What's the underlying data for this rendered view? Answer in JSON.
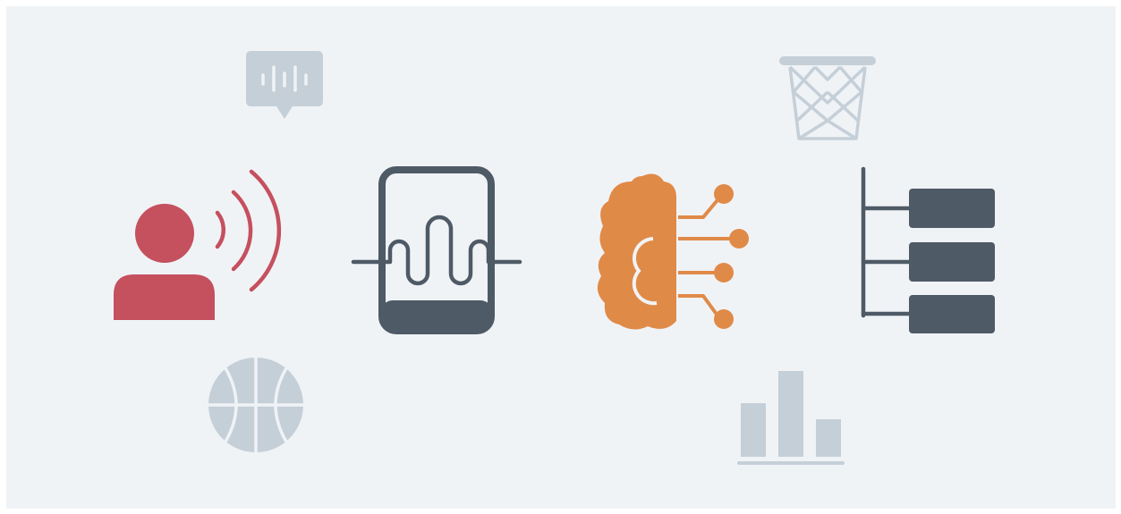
{
  "colors": {
    "background": "#f0f3f6",
    "speaker": "#c5505e",
    "phone": "#4e5a66",
    "brain": "#e08a48",
    "hierarchy": "#4e5a66",
    "decor": "#c5cfd8"
  },
  "icons": {
    "speech_bubble": "speech-waveform-bubble-icon",
    "basketball_hoop": "basketball-hoop-icon",
    "person_speaking": "person-speaking-icon",
    "phone_waveform": "phone-waveform-icon",
    "ai_brain": "ai-brain-circuit-icon",
    "hierarchy_list": "hierarchy-list-icon",
    "basketball": "basketball-icon",
    "bar_chart": "bar-chart-icon"
  }
}
